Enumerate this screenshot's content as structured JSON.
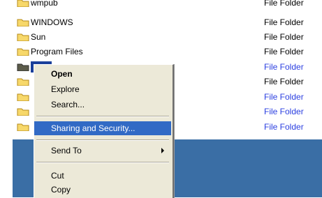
{
  "file_list": {
    "rows": [
      {
        "name": "wmpub",
        "type": "File Folder"
      },
      {
        "name": "WINDOWS",
        "type": "File Folder"
      },
      {
        "name": "Sun",
        "type": "File Folder"
      },
      {
        "name": "Program Files",
        "type": "File Folder"
      },
      {
        "name": "",
        "type": "File Folder"
      },
      {
        "name": "",
        "type": "File Folder"
      },
      {
        "name": "",
        "type": "File Folder"
      },
      {
        "name": "",
        "type": "File Folder"
      },
      {
        "name": "",
        "type": "File Folder"
      }
    ]
  },
  "context_menu": {
    "open": "Open",
    "explore": "Explore",
    "search": "Search...",
    "sharing": "Sharing and Security...",
    "send_to": "Send To",
    "cut": "Cut",
    "copy": "Copy"
  },
  "colors": {
    "selection": "#316ac5",
    "desktop": "#3a6ea5",
    "folder_yellow": "#f7d86a",
    "link_blue": "#2a3ee0"
  }
}
